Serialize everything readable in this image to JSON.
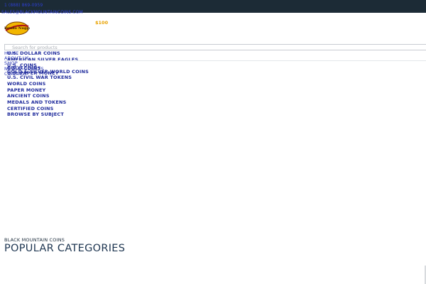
{
  "topbar": {
    "phone": "1 (888) 869-0959",
    "email": "SALES@BLACKMOUNTAINCOINS.COM"
  },
  "logo": {
    "text": "Colorado Nuggets"
  },
  "header": {
    "price": "$100"
  },
  "search": {
    "placeholder": "Search for products"
  },
  "nav": {
    "items": [
      {
        "label": "HOME"
      },
      {
        "label": "ABOUT US"
      },
      {
        "label": "SHOP"
      },
      {
        "label": "NEW PRODUCTS"
      },
      {
        "label": "CONTACT"
      }
    ]
  },
  "categories": {
    "items": [
      {
        "label": "U.S. DOLLAR COINS"
      },
      {
        "label": "AMERICAN SILVER EAGLES"
      },
      {
        "label": "U.S. COINS"
      },
      {
        "label": "GOLD COINS"
      },
      {
        "label": "GOLD & SILVER WORLD COINS"
      },
      {
        "label": "U.S. PAPER MONEY"
      },
      {
        "label": "U.S. CIVIL WAR TOKENS"
      },
      {
        "label": "WORLD COINS"
      },
      {
        "label": "PAPER MONEY"
      },
      {
        "label": "ANCIENT COINS"
      },
      {
        "label": "MEDALS AND TOKENS"
      },
      {
        "label": "CERTIFIED COINS"
      },
      {
        "label": "BROWSE BY SUBJECT"
      }
    ]
  },
  "section": {
    "subtitle": "BLACK MOUNTAIN COINS",
    "title": "POPULAR CATEGORIES"
  }
}
